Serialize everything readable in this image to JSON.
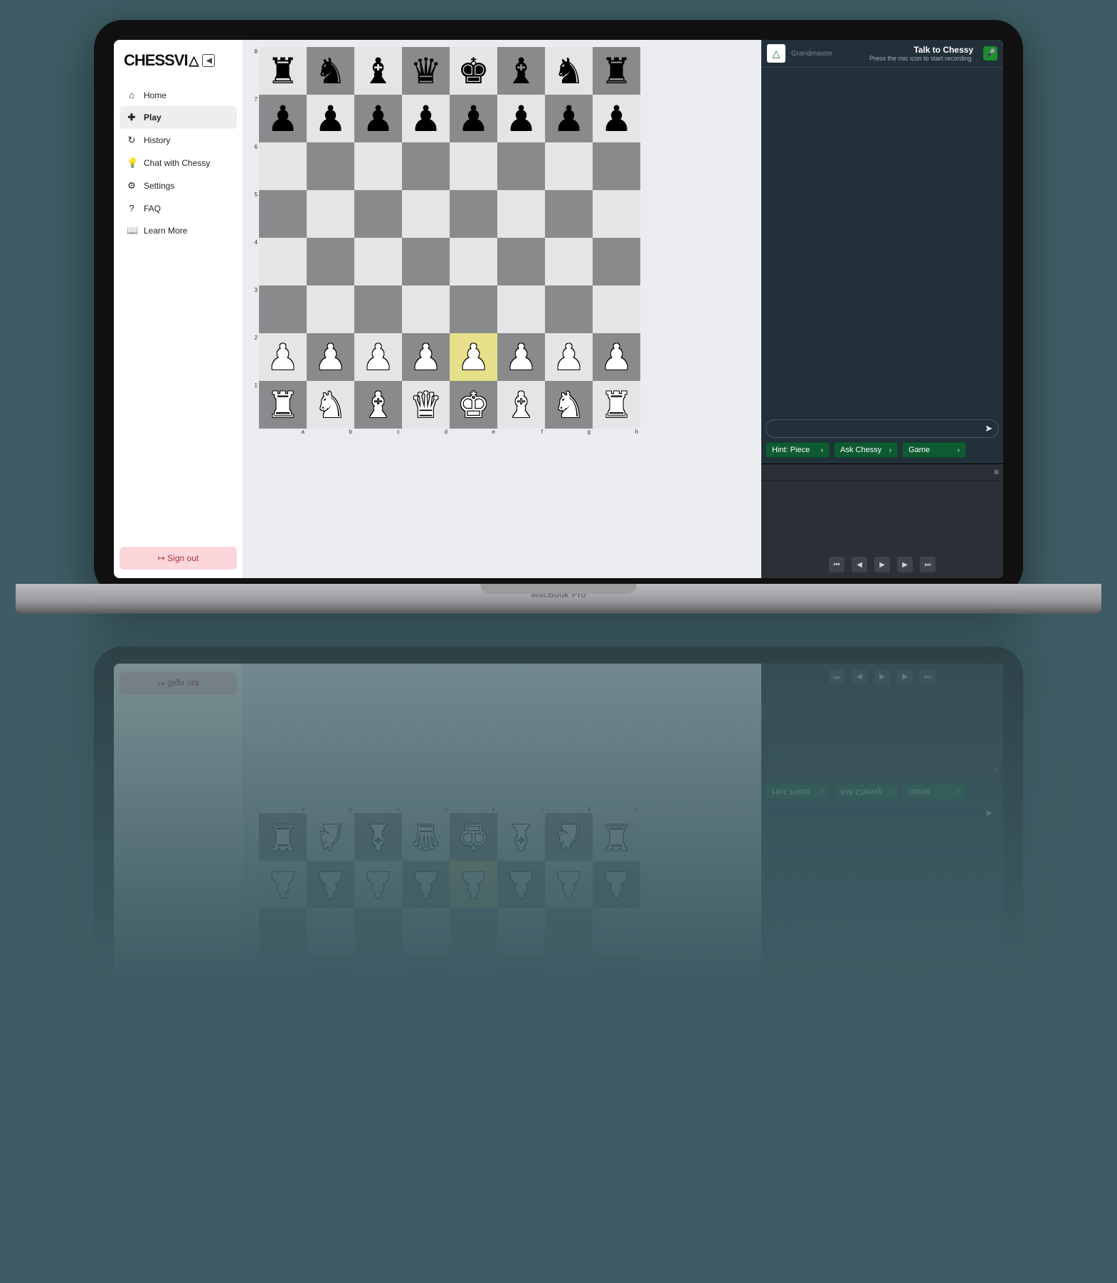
{
  "brand": {
    "name": "CHESSVI",
    "collapse_glyph": "◀",
    "logo_glyph": "△"
  },
  "nav": [
    {
      "icon": "⌂",
      "label": "Home",
      "active": false,
      "name": "nav-home"
    },
    {
      "icon": "✚",
      "label": "Play",
      "active": true,
      "name": "nav-play"
    },
    {
      "icon": "↻",
      "label": "History",
      "active": false,
      "name": "nav-history"
    },
    {
      "icon": "💡",
      "label": "Chat with Chessy",
      "active": false,
      "name": "nav-chat"
    },
    {
      "icon": "⚙",
      "label": "Settings",
      "active": false,
      "name": "nav-settings"
    },
    {
      "icon": "?",
      "label": "FAQ",
      "active": false,
      "name": "nav-faq"
    },
    {
      "icon": "📖",
      "label": "Learn More",
      "active": false,
      "name": "nav-learn"
    }
  ],
  "signout": {
    "glyph": "↦",
    "label": "Sign out"
  },
  "board": {
    "ranks": [
      "8",
      "7",
      "6",
      "5",
      "4",
      "3",
      "2",
      "1"
    ],
    "files": [
      "a",
      "b",
      "c",
      "d",
      "e",
      "f",
      "g",
      "h"
    ],
    "highlight": "e2",
    "position": {
      "a8": "br",
      "b8": "bn",
      "c8": "bb",
      "d8": "bq",
      "e8": "bk",
      "f8": "bb",
      "g8": "bn",
      "h8": "br",
      "a7": "bp",
      "b7": "bp",
      "c7": "bp",
      "d7": "bp",
      "e7": "bp",
      "f7": "bp",
      "g7": "bp",
      "h7": "bp",
      "a2": "wp",
      "b2": "wp",
      "c2": "wp",
      "d2": "wp",
      "e2": "wp",
      "f2": "wp",
      "g2": "wp",
      "h2": "wp",
      "a1": "wr",
      "b1": "wn",
      "c1": "wb",
      "d1": "wq",
      "e1": "wk",
      "f1": "wb",
      "g1": "wn",
      "h1": "wr"
    }
  },
  "chat": {
    "avatar_glyph": "△",
    "grandmaster": "Grandmaster",
    "title": "Talk to Chessy",
    "subtitle": "Press the mic icon to start recording.",
    "input_placeholder": "",
    "send_glyph": "➤",
    "mic_glyph": "🎤",
    "hints": [
      {
        "label": "Hint: Piece",
        "name": "hint-piece"
      },
      {
        "label": "Ask Chessy",
        "name": "hint-ask"
      },
      {
        "label": "Game",
        "name": "hint-game"
      }
    ]
  },
  "moves": {
    "settings_glyph": "≡",
    "controls": [
      {
        "glyph": "⏮",
        "name": "moves-first"
      },
      {
        "glyph": "◀",
        "name": "moves-prev"
      },
      {
        "glyph": "▶",
        "name": "moves-play"
      },
      {
        "glyph": "▶",
        "name": "moves-next"
      },
      {
        "glyph": "⏭",
        "name": "moves-last"
      }
    ]
  },
  "laptop_label": "MacBook Pro",
  "pieces": {
    "k": "♚",
    "q": "♛",
    "r": "♜",
    "b": "♝",
    "n": "♞",
    "p": "♟"
  }
}
